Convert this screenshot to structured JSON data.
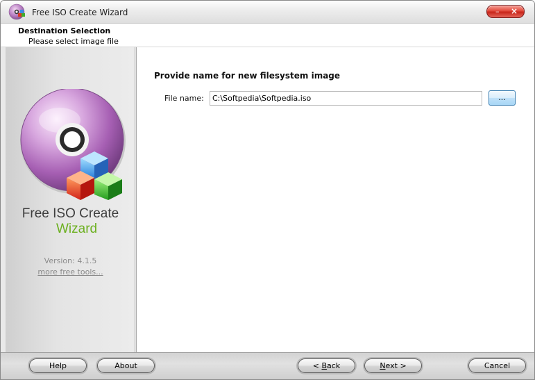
{
  "window": {
    "title": "Free ISO Create Wizard",
    "close_glyph": "×",
    "minimize_glyph": "–"
  },
  "header": {
    "title": "Destination Selection",
    "subtitle": "Please select image file"
  },
  "sidebar": {
    "product_name_line1": "Free ISO Create",
    "product_name_line2": "Wizard",
    "version": "Version: 4.1.5",
    "more_tools_link": "more free tools...",
    "logo_icon": "disc-with-cubes-icon",
    "accent_color": "#6cb020"
  },
  "main": {
    "heading": "Provide name for new filesystem image",
    "file_name_label": "File name:",
    "file_name_value": "C:\\Softpedia\\Softpedia.iso",
    "browse_label": "..."
  },
  "buttons": {
    "help": "Help",
    "about": "About",
    "back_prefix": "< ",
    "back_key": "B",
    "back_rest": "ack",
    "next_key": "N",
    "next_rest": "ext >",
    "cancel": "Cancel"
  }
}
